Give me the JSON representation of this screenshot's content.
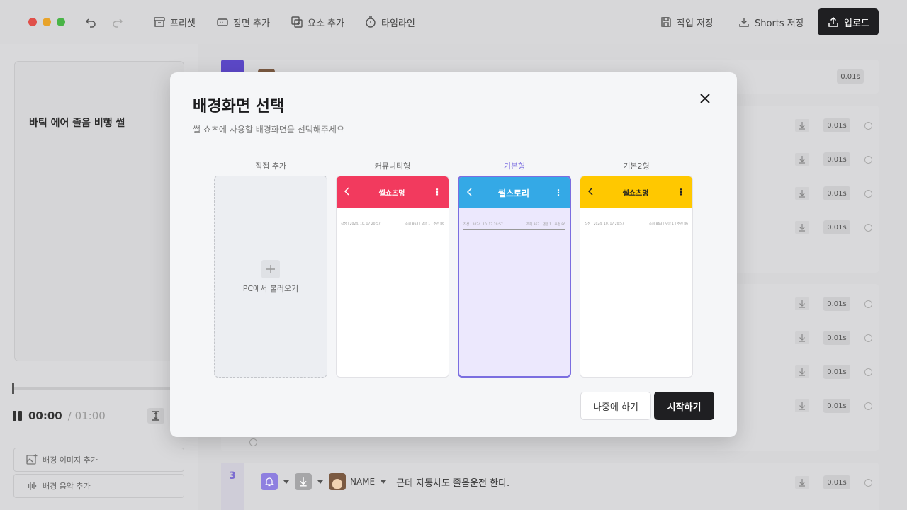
{
  "toolbar": {
    "window_controls": [
      "#e0504a",
      "#e8a32a",
      "#49b447"
    ],
    "items": [
      {
        "label": "프리셋",
        "icon": "archive-icon"
      },
      {
        "label": "장면 추가",
        "icon": "scene-icon"
      },
      {
        "label": "요소 추가",
        "icon": "add-element-icon"
      },
      {
        "label": "타임라인",
        "icon": "stopwatch-icon"
      }
    ],
    "save_work": "작업 저장",
    "save_shorts": "Shorts 저장",
    "upload": "업로드"
  },
  "left_panel": {
    "preview_title": "바틱 에어 졸음 비행 썰",
    "current_time": "00:00",
    "total_time": "/ 01:00",
    "add_bg_image": "배경 이미지 추가",
    "add_bg_music": "배경 음악 추가"
  },
  "timeline": {
    "duration": "0.01s",
    "scene3_number": "3",
    "speaker": "NAME",
    "scene3_text": "근데 자동차도 졸음운전 한다."
  },
  "modal": {
    "title": "배경화면 선택",
    "subtitle": "썰 쇼츠에 사용할 배경화면을 선택해주세요",
    "options": [
      {
        "label": "직접 추가",
        "add_text": "PC에서 불러오기"
      },
      {
        "label": "커뮤니티형",
        "header_title": "썰쇼츠명",
        "color": "#f23a5e",
        "meta_left": "작성 | 2024. 10. 17 20:57",
        "meta_right": "조회 863 | 댓글 1 | 추천 86"
      },
      {
        "label": "기본형",
        "header_title": "썰스토리",
        "color": "#34a9e6",
        "meta_left": "작성 | 2024. 10. 17 20:57",
        "meta_right": "조회 863 | 댓글 1 | 추천 86"
      },
      {
        "label": "기본2형",
        "header_title": "썰쇼츠명",
        "color": "#ffc800",
        "meta_left": "작성 | 2024. 10. 17 20:57",
        "meta_right": "조회 863 | 댓글 1 | 추천 86"
      }
    ],
    "later_button": "나중에 하기",
    "start_button": "시작하기",
    "accent": "#7b6ee0"
  }
}
